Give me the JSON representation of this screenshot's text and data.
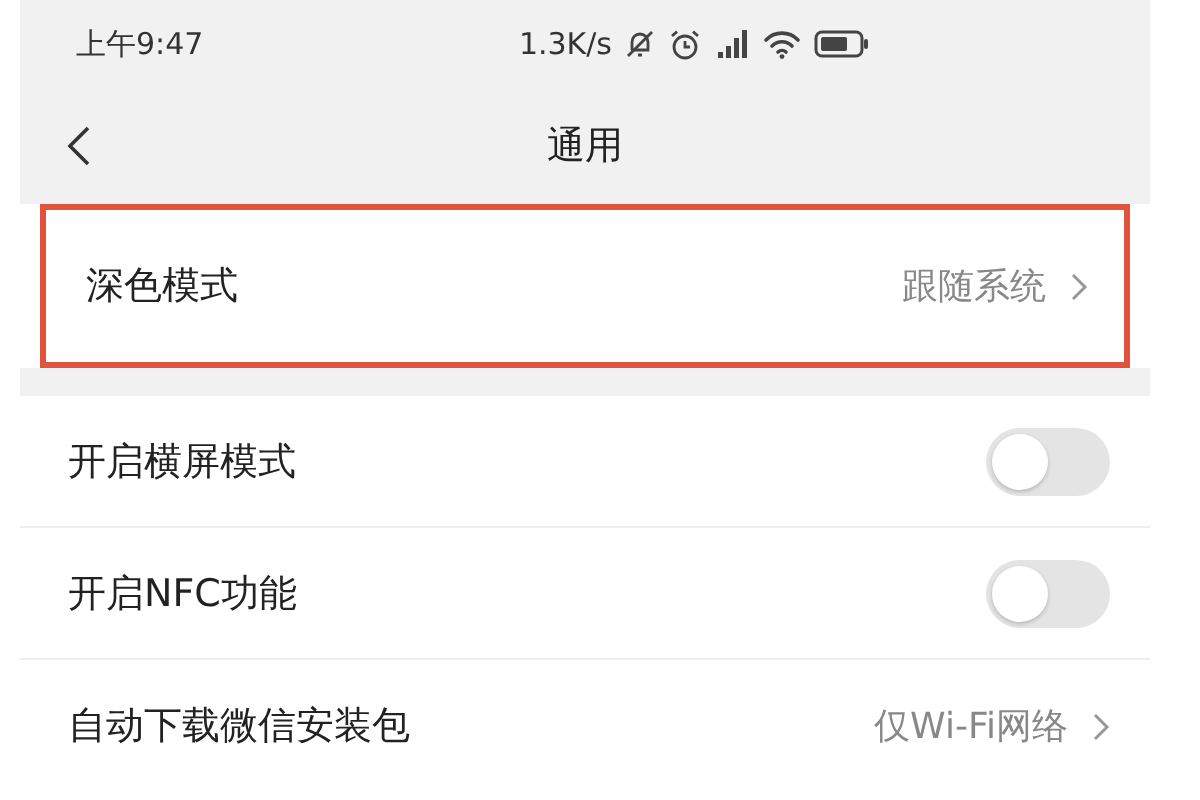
{
  "status_bar": {
    "time": "上午9:47",
    "net_speed": "1.3K/s"
  },
  "nav": {
    "title": "通用"
  },
  "top_item": {
    "label": "深色模式",
    "value": "跟随系统",
    "highlighted": true
  },
  "items": [
    {
      "kind": "toggle",
      "label": "开启横屏模式",
      "on": false
    },
    {
      "kind": "toggle",
      "label": "开启NFC功能",
      "on": false
    },
    {
      "kind": "value",
      "label": "自动下载微信安装包",
      "value": "仅Wi-Fi网络"
    }
  ]
}
